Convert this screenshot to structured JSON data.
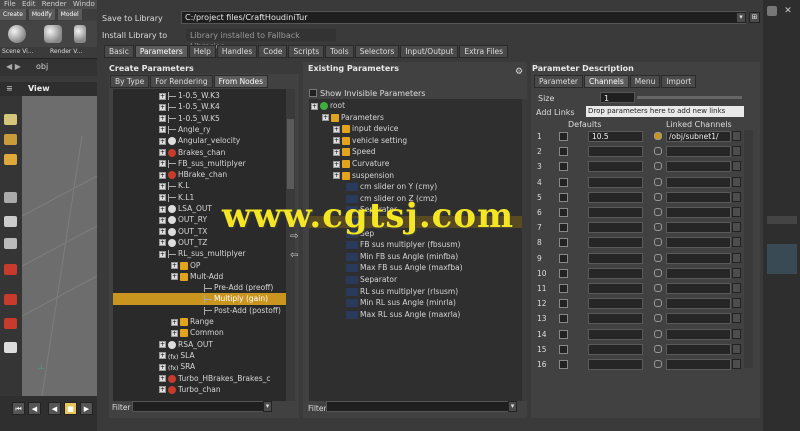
{
  "houdini": {
    "menu": [
      "File",
      "Edit",
      "Render",
      "Windo"
    ],
    "shelf_tabs": [
      "Create",
      "Modify",
      "Model"
    ],
    "shelf_labels": [
      "Scene Vi...",
      "Render V..."
    ],
    "path": "obj",
    "pane_title": "View"
  },
  "dialog": {
    "save_label": "Save to Library",
    "save_path": "C:/project files/CraftHoudiniTur",
    "install_label": "Install Library to",
    "install_value": "Library installed to Fallback Libraries",
    "tabs": [
      "Basic",
      "Parameters",
      "Help",
      "Handles",
      "Code",
      "Scripts",
      "Tools",
      "Selectors",
      "Input/Output",
      "Extra Files"
    ],
    "active_tab": "Parameters"
  },
  "create_params": {
    "title": "Create Parameters",
    "tabs": [
      "By Type",
      "For Rendering",
      "From Nodes"
    ],
    "items": [
      {
        "label": "1-0.5_W.K3",
        "icon": "slider",
        "expander": true,
        "indent": 4
      },
      {
        "label": "1-0.5_W.K4",
        "icon": "slider",
        "expander": true,
        "indent": 4
      },
      {
        "label": "1-0.5_W.K5",
        "icon": "slider",
        "expander": true,
        "indent": 4
      },
      {
        "label": "Angle_ry",
        "icon": "angle",
        "expander": true,
        "indent": 4
      },
      {
        "label": "Angular_velocity",
        "icon": "white",
        "expander": true,
        "indent": 4
      },
      {
        "label": "Brakes_chan",
        "icon": "red",
        "expander": true,
        "indent": 4
      },
      {
        "label": "FB_sus_multiplyer",
        "icon": "slider",
        "expander": true,
        "indent": 4
      },
      {
        "label": "HBrake_chan",
        "icon": "red",
        "expander": true,
        "indent": 4
      },
      {
        "label": "K.L",
        "icon": "slider",
        "expander": true,
        "indent": 4
      },
      {
        "label": "K.L1",
        "icon": "slider",
        "expander": true,
        "indent": 4
      },
      {
        "label": "LSA_OUT",
        "icon": "white",
        "expander": true,
        "indent": 4
      },
      {
        "label": "OUT_RY",
        "icon": "white",
        "expander": true,
        "indent": 4
      },
      {
        "label": "OUT_TX",
        "icon": "white",
        "expander": true,
        "indent": 4
      },
      {
        "label": "OUT_TZ",
        "icon": "white",
        "expander": true,
        "indent": 4
      },
      {
        "label": "RL_sus_multiplyer",
        "icon": "slider",
        "expander": true,
        "indent": 4
      },
      {
        "label": "OP",
        "icon": "folder",
        "expander": true,
        "indent": 5
      },
      {
        "label": "Mult-Add",
        "icon": "folder",
        "expander": true,
        "indent": 5
      },
      {
        "label": "Pre-Add (preoff)",
        "icon": "param",
        "expander": false,
        "indent": 7
      },
      {
        "label": "Multiply (gain)",
        "icon": "param",
        "expander": false,
        "indent": 7,
        "selected": true
      },
      {
        "label": "Post-Add (postoff)",
        "icon": "param",
        "expander": false,
        "indent": 7
      },
      {
        "label": "Range",
        "icon": "folder",
        "expander": true,
        "indent": 5
      },
      {
        "label": "Common",
        "icon": "folder",
        "expander": true,
        "indent": 5
      },
      {
        "label": "RSA_OUT",
        "icon": "white",
        "expander": true,
        "indent": 4
      },
      {
        "label": "SLA",
        "icon": "fn",
        "expander": true,
        "indent": 4
      },
      {
        "label": "SRA",
        "icon": "fn",
        "expander": true,
        "indent": 4
      },
      {
        "label": "Turbo_HBrakes_Brakes_c",
        "icon": "red",
        "expander": true,
        "indent": 4
      },
      {
        "label": "Turbo_chan",
        "icon": "red",
        "expander": true,
        "indent": 4
      }
    ],
    "filter_label": "Filter"
  },
  "existing_params": {
    "title": "Existing Parameters",
    "show_invisible": "Show Invisible Parameters",
    "items": [
      {
        "label": "root",
        "icon": "root",
        "indent": 0,
        "expander": true
      },
      {
        "label": "Parameters",
        "icon": "folder",
        "indent": 1,
        "expander": true
      },
      {
        "label": "input device",
        "icon": "folder",
        "indent": 2,
        "expander": true
      },
      {
        "label": "vehicle setting",
        "icon": "folder",
        "indent": 2,
        "expander": true
      },
      {
        "label": "Speed",
        "icon": "folder",
        "indent": 2,
        "expander": true
      },
      {
        "label": "Curvature",
        "icon": "folder",
        "indent": 2,
        "expander": true
      },
      {
        "label": "suspension",
        "icon": "folder",
        "indent": 2,
        "expander": true
      },
      {
        "label": "cm slider on Y (cmy)",
        "icon": "param",
        "indent": 3,
        "expander": false
      },
      {
        "label": "cm slider on Z (cmz)",
        "icon": "param",
        "indent": 3,
        "expander": false
      },
      {
        "label": "Separator",
        "icon": "param",
        "indent": 3,
        "expander": false
      },
      {
        "label": "",
        "icon": "param",
        "indent": 3,
        "expander": false,
        "highlight": true
      },
      {
        "label": "Sep",
        "icon": "param",
        "indent": 3,
        "expander": false
      },
      {
        "label": "FB sus multiplyer (fbsusm)",
        "icon": "param",
        "indent": 3,
        "expander": false
      },
      {
        "label": "Min FB sus Angle (minfba)",
        "icon": "param",
        "indent": 3,
        "expander": false
      },
      {
        "label": "Max FB sus Angle (maxfba)",
        "icon": "param",
        "indent": 3,
        "expander": false
      },
      {
        "label": "Separator",
        "icon": "param",
        "indent": 3,
        "expander": false
      },
      {
        "label": "RL sus multiplyer (rlsusm)",
        "icon": "param",
        "indent": 3,
        "expander": false
      },
      {
        "label": "Min RL sus Angle (minrla)",
        "icon": "param",
        "indent": 3,
        "expander": false
      },
      {
        "label": "Max RL sus Angle (maxrla)",
        "icon": "param",
        "indent": 3,
        "expander": false
      }
    ],
    "filter_label": "Filter"
  },
  "param_desc": {
    "title": "Parameter Description",
    "tabs": [
      "Parameter",
      "Channels",
      "Menu",
      "Import"
    ],
    "active_tab": "Channels",
    "size_label": "Size",
    "size_value": "1",
    "add_links_label": "Add Links",
    "drop_hint": "Drop parameters here to add new links",
    "defaults_header": "Defaults",
    "linked_header": "Linked Channels",
    "rows": [
      "1",
      "2",
      "3",
      "4",
      "5",
      "6",
      "7",
      "8",
      "9",
      "10",
      "11",
      "12",
      "13",
      "14",
      "15",
      "16"
    ],
    "row1_default": "10.5",
    "row1_linked": "/obj/subnet1/"
  },
  "watermark": "www.cgtsj.com"
}
